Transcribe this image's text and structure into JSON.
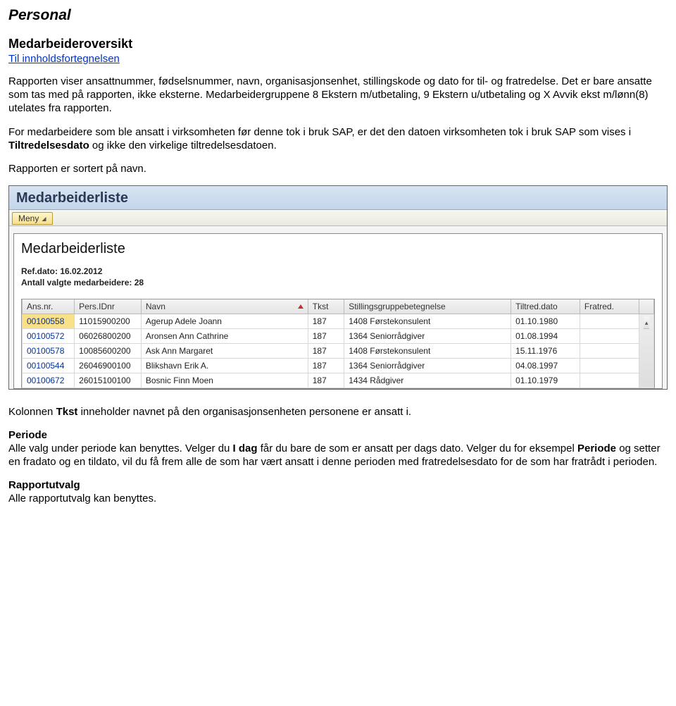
{
  "doc": {
    "section_title": "Personal",
    "heading": "Medarbeideroversikt",
    "toc_link": "Til innholdsfortegnelsen",
    "para1": "Rapporten viser ansattnummer, fødselsnummer, navn, organisasjonsenhet, stillingskode og dato for til- og fratredelse. Det er bare ansatte som tas med på rapporten, ikke eksterne. Medarbeidergruppene 8 Ekstern m/utbetaling, 9 Ekstern u/utbetaling og X Avvik ekst m/lønn(8) utelates fra rapporten.",
    "para2_a": "For medarbeidere som ble ansatt i virksomheten før denne tok i bruk SAP, er det den datoen virksomheten tok i bruk SAP som vises i ",
    "para2_b": "Tiltredelsesdato",
    "para2_c": " og ikke den virkelige tiltredelsesdatoen.",
    "para3": "Rapporten er sortert på navn.",
    "para4_a": "Kolonnen ",
    "para4_b": "Tkst",
    "para4_c": " inneholder navnet på den organisasjonsenheten personene er ansatt i.",
    "periode_label": "Periode",
    "para5_a": "Alle valg under periode kan benyttes. Velger du ",
    "para5_b": "I dag",
    "para5_c": " får du bare de som er ansatt per dags dato. Velger du for eksempel ",
    "para5_d": "Periode",
    "para5_e": " og setter en fradato og en tildato, vil du få frem alle de som har vært ansatt i denne perioden med fratredelsesdato for de som har fratrådt i perioden.",
    "rapportutvalg_label": "Rapportutvalg",
    "para6": "Alle rapportutvalg kan benyttes."
  },
  "app": {
    "titlebar": "Medarbeiderliste",
    "menu_label": "Meny",
    "report_title": "Medarbeiderliste",
    "ref_date_line": "Ref.dato: 16.02.2012",
    "count_line": "Antall valgte medarbeidere: 28",
    "columns": {
      "ans": "Ans.nr.",
      "pid": "Pers.IDnr",
      "navn": "Navn",
      "tkst": "Tkst",
      "stg": "Stillingsgruppebetegnelse",
      "til": "Tiltred.dato",
      "fra": "Fratred."
    },
    "rows": [
      {
        "ans": "00100558",
        "pid": "11015900200",
        "navn": "Agerup Adele Joann",
        "tkst": "187",
        "stg": "1408 Førstekonsulent",
        "til": "01.10.1980",
        "fra": ""
      },
      {
        "ans": "00100572",
        "pid": "06026800200",
        "navn": "Aronsen Ann Cathrine",
        "tkst": "187",
        "stg": "1364 Seniorrådgiver",
        "til": "01.08.1994",
        "fra": ""
      },
      {
        "ans": "00100578",
        "pid": "10085600200",
        "navn": "Ask Ann Margaret",
        "tkst": "187",
        "stg": "1408 Førstekonsulent",
        "til": "15.11.1976",
        "fra": ""
      },
      {
        "ans": "00100544",
        "pid": "26046900100",
        "navn": "Blikshavn Erik A.",
        "tkst": "187",
        "stg": "1364 Seniorrådgiver",
        "til": "04.08.1997",
        "fra": ""
      },
      {
        "ans": "00100672",
        "pid": "26015100100",
        "navn": "Bosnic Finn Moen",
        "tkst": "187",
        "stg": "1434 Rådgiver",
        "til": "01.10.1979",
        "fra": ""
      }
    ]
  }
}
